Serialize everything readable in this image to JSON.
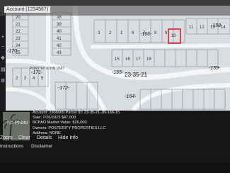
{
  "map": {
    "account_tab": "Account (1234567)",
    "title": "-166-",
    "lot_numbers": [
      "20",
      "21",
      "22",
      "23",
      "24",
      "25",
      "38",
      "39",
      "40",
      "41",
      "42",
      "43",
      "3",
      "2",
      "1",
      "6",
      "7",
      "8",
      "9",
      "10",
      "11",
      "12",
      "13",
      "14",
      "15",
      "16",
      "17",
      "18",
      "2",
      "3",
      "4",
      "5"
    ],
    "section_labels": [
      "-166-",
      "-171-",
      "-172-",
      "-165-",
      "-170-",
      "-158-",
      "-159-",
      "-164-"
    ],
    "township_label": "23-35-21",
    "road_label": "PORT ST JOHN UNIT"
  },
  "panel": {
    "photo": "No Photo",
    "account_line": "Account: 2306009   Parcel ID: 23-35-21-JN-166-15",
    "sale_line": "Sale: 7/26/2023 $47,000",
    "value_line": "BCPAO Market Value: $26,000",
    "owners_line": "Owners: POSTERITY PROPERTIES LLC",
    "address_line": "Address: NONE",
    "actions": [
      "Zoom",
      "Clear",
      "Details",
      "Hide Info"
    ],
    "links": [
      "Instructions",
      "Disclaimer"
    ]
  },
  "colors": {
    "parcel_highlight": "#d8202a",
    "map_background": "#d9dde2",
    "lot_lines": "#7f8b99"
  }
}
